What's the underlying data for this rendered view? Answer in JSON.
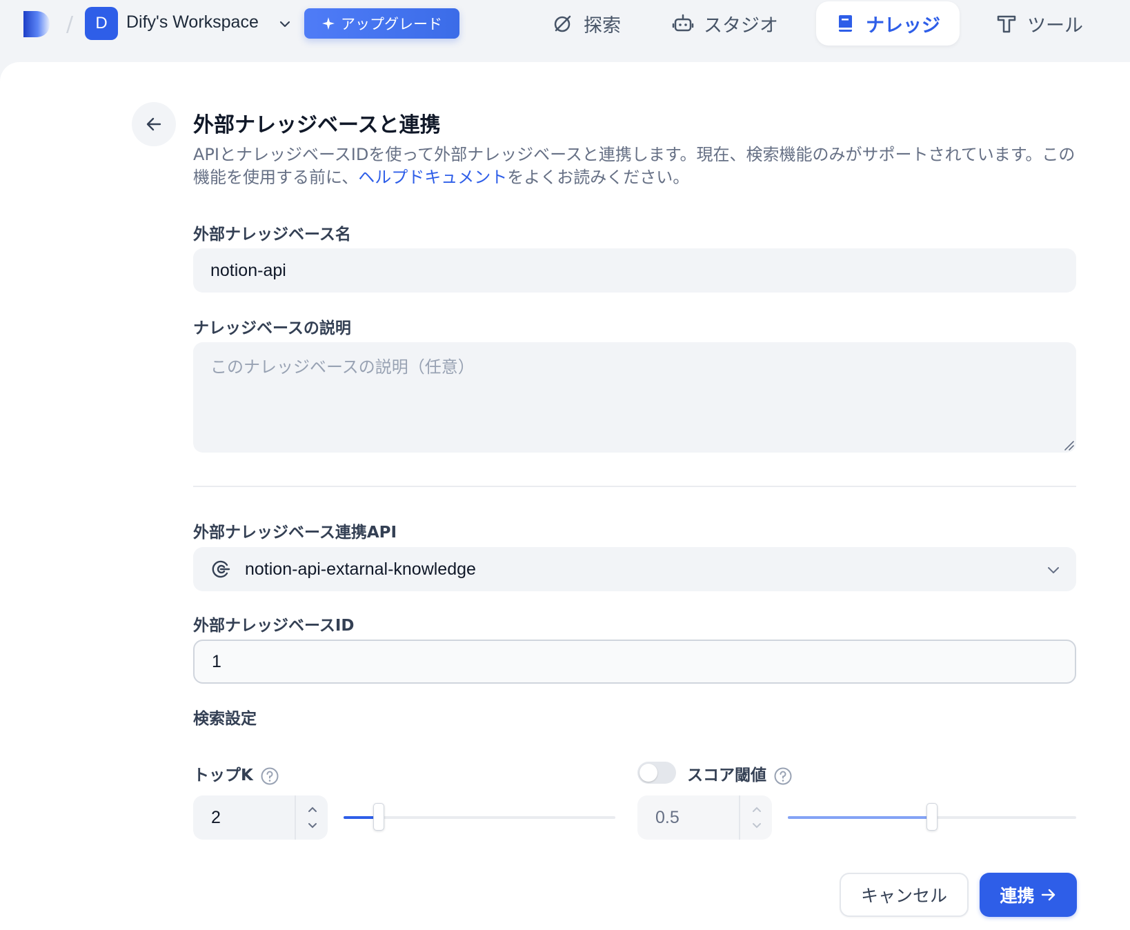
{
  "header": {
    "workspace_initial": "D",
    "workspace_name": "Dify's Workspace",
    "upgrade_label": "アップグレード",
    "nav": {
      "explore": "探索",
      "studio": "スタジオ",
      "knowledge": "ナレッジ",
      "tools": "ツール"
    },
    "active_nav": "knowledge"
  },
  "page": {
    "title": "外部ナレッジベースと連携",
    "description_before_link": "APIとナレッジベースIDを使って外部ナレッジベースと連携します。現在、検索機能のみがサポートされています。この機能を使用する前に、",
    "help_link": "ヘルプドキュメント",
    "description_after_link": "をよくお読みください。"
  },
  "form": {
    "name_label": "外部ナレッジベース名",
    "name_value": "notion-api",
    "desc_label": "ナレッジベースの説明",
    "desc_placeholder": "このナレッジベースの説明（任意）",
    "api_label": "外部ナレッジベース連携API",
    "api_value": "notion-api-extarnal-knowledge",
    "id_label": "外部ナレッジベースID",
    "id_value": "1",
    "retrieval_label": "検索設定",
    "topk_label": "トップK",
    "topk_value": "2",
    "topk_slider_fraction": 0.13,
    "score_label": "スコア閾値",
    "score_enabled": false,
    "score_value": "0.5",
    "score_slider_fraction": 0.5
  },
  "actions": {
    "cancel": "キャンセル",
    "connect": "連携"
  },
  "colors": {
    "accent": "#2e5ee8",
    "background": "#f2f4f7",
    "panel": "#ffffff"
  }
}
